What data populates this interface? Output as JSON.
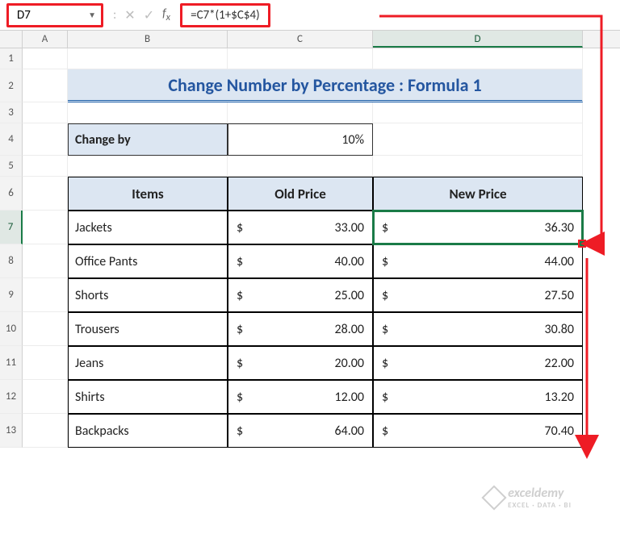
{
  "nameBox": "D7",
  "formula": "=C7*(1+$C$4)",
  "columns": {
    "A": "A",
    "B": "B",
    "C": "C",
    "D": "D"
  },
  "rows": [
    "1",
    "2",
    "3",
    "4",
    "5",
    "6",
    "7",
    "8",
    "9",
    "10",
    "11",
    "12",
    "13"
  ],
  "title": "Change Number by Percentage : Formula 1",
  "changeBy": {
    "label": "Change by",
    "value": "10%"
  },
  "headers": {
    "items": "Items",
    "old": "Old Price",
    "new": "New Price"
  },
  "currency": "$",
  "items": [
    {
      "name": "Jackets",
      "old": "33.00",
      "new": "36.30"
    },
    {
      "name": "Office Pants",
      "old": "40.00",
      "new": "44.00"
    },
    {
      "name": "Shorts",
      "old": "25.00",
      "new": "27.50"
    },
    {
      "name": "Trousers",
      "old": "28.00",
      "new": "30.80"
    },
    {
      "name": "Jeans",
      "old": "20.00",
      "new": "22.00"
    },
    {
      "name": "Shirts",
      "old": "12.00",
      "new": "13.20"
    },
    {
      "name": "Backpacks",
      "old": "64.00",
      "new": "70.40"
    }
  ],
  "watermark": {
    "brand": "exceldemy",
    "tagline": "EXCEL · DATA · BI"
  }
}
